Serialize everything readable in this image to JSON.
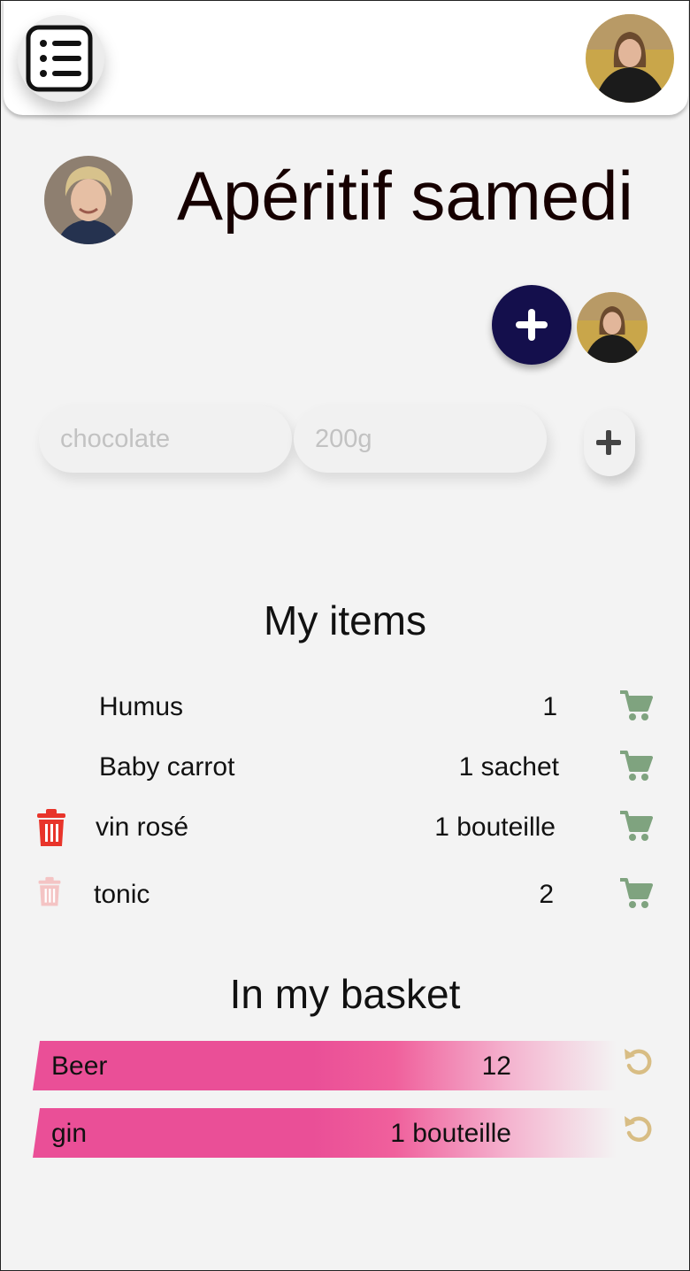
{
  "header": {
    "menu_icon": "list-icon",
    "user_avatar": "user-avatar"
  },
  "list": {
    "title": "Apéritif samedi",
    "owner_avatar": "owner-avatar",
    "add_member_icon": "plus-icon",
    "member_avatar": "member-avatar"
  },
  "new_item": {
    "name_placeholder": "chocolate",
    "quantity_placeholder": "200g",
    "add_icon": "plus-icon"
  },
  "my_items": {
    "heading": "My items",
    "items": [
      {
        "name": "Humus",
        "quantity": "1",
        "deletable": false
      },
      {
        "name": "Baby carrot",
        "quantity": "1 sachet",
        "deletable": false
      },
      {
        "name": "vin rosé",
        "quantity": "1 bouteille",
        "deletable": true
      },
      {
        "name": "tonic",
        "quantity": "2",
        "deletable": true
      }
    ]
  },
  "basket": {
    "heading": "In my basket",
    "items": [
      {
        "name": "Beer",
        "quantity": "12"
      },
      {
        "name": "gin",
        "quantity": "1 bouteille"
      }
    ]
  },
  "colors": {
    "background": "#f3f3f3",
    "accent_navy": "#140f4c",
    "cart_green": "#7fa37f",
    "trash_red": "#e8342a",
    "trash_faded": "#f4c4c4",
    "basket_pink": "#ea4f97",
    "undo_gold": "#d8bd84"
  }
}
